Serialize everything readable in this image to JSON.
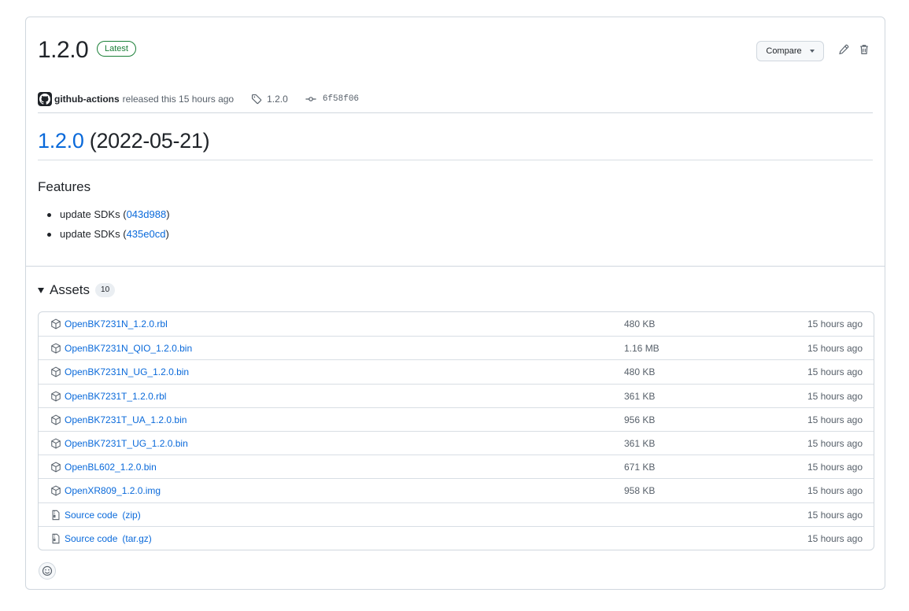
{
  "release": {
    "version": "1.2.0",
    "latest_label": "Latest",
    "author": "github-actions",
    "released_text": "released this 15 hours ago",
    "tag": "1.2.0",
    "commit": "6f58f06",
    "compare_label": "Compare"
  },
  "body": {
    "heading_link": "1.2.0",
    "heading_date": "(2022-05-21)",
    "features_title": "Features",
    "features": [
      {
        "text": "update SDKs",
        "open": " (",
        "link": "043d988",
        "close": ")"
      },
      {
        "text": "update SDKs",
        "open": " (",
        "link": "435e0cd",
        "close": ")"
      }
    ]
  },
  "assets": {
    "title": "Assets",
    "count": "10",
    "items": [
      {
        "name": "OpenBK7231N_1.2.0.rbl",
        "size": "480 KB",
        "time": "15 hours ago",
        "icon": "package-icon"
      },
      {
        "name": "OpenBK7231N_QIO_1.2.0.bin",
        "size": "1.16 MB",
        "time": "15 hours ago",
        "icon": "package-icon"
      },
      {
        "name": "OpenBK7231N_UG_1.2.0.bin",
        "size": "480 KB",
        "time": "15 hours ago",
        "icon": "package-icon"
      },
      {
        "name": "OpenBK7231T_1.2.0.rbl",
        "size": "361 KB",
        "time": "15 hours ago",
        "icon": "package-icon"
      },
      {
        "name": "OpenBK7231T_UA_1.2.0.bin",
        "size": "956 KB",
        "time": "15 hours ago",
        "icon": "package-icon"
      },
      {
        "name": "OpenBK7231T_UG_1.2.0.bin",
        "size": "361 KB",
        "time": "15 hours ago",
        "icon": "package-icon"
      },
      {
        "name": "OpenBL602_1.2.0.bin",
        "size": "671 KB",
        "time": "15 hours ago",
        "icon": "package-icon"
      },
      {
        "name": "OpenXR809_1.2.0.img",
        "size": "958 KB",
        "time": "15 hours ago",
        "icon": "package-icon"
      },
      {
        "name": "Source code",
        "suffix": "(zip)",
        "size": "",
        "time": "15 hours ago",
        "icon": "file-zip-icon"
      },
      {
        "name": "Source code",
        "suffix": "(tar.gz)",
        "size": "",
        "time": "15 hours ago",
        "icon": "file-zip-icon"
      }
    ]
  },
  "colors": {
    "link": "#0969da",
    "latest": "#1a7f37",
    "border": "#d0d7de",
    "muted": "#57606a"
  }
}
